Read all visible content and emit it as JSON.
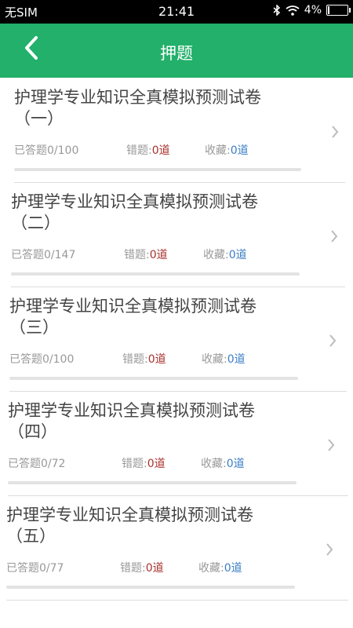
{
  "status_bar": {
    "carrier": "无SIM",
    "time": "21:41",
    "battery": "4%"
  },
  "header": {
    "title": "押题"
  },
  "items": [
    {
      "title": "护理学专业知识全真模拟预测试卷（一）",
      "answered": "已答题0/100",
      "wrong_label": "错题:",
      "wrong_value": "0道",
      "fav_label": "收藏:",
      "fav_value": "0道"
    },
    {
      "title": "护理学专业知识全真模拟预测试卷（二）",
      "answered": "已答题0/147",
      "wrong_label": "错题:",
      "wrong_value": "0道",
      "fav_label": "收藏:",
      "fav_value": "0道"
    },
    {
      "title": "护理学专业知识全真模拟预测试卷（三）",
      "answered": "已答题0/100",
      "wrong_label": "错题:",
      "wrong_value": "0道",
      "fav_label": "收藏:",
      "fav_value": "0道"
    },
    {
      "title": "护理学专业知识全真模拟预测试卷（四）",
      "answered": "已答题0/72",
      "wrong_label": "错题:",
      "wrong_value": "0道",
      "fav_label": "收藏:",
      "fav_value": "0道"
    },
    {
      "title": "护理学专业知识全真模拟预测试卷（五）",
      "answered": "已答题0/77",
      "wrong_label": "错题:",
      "wrong_value": "0道",
      "fav_label": "收藏:",
      "fav_value": "0道"
    }
  ]
}
